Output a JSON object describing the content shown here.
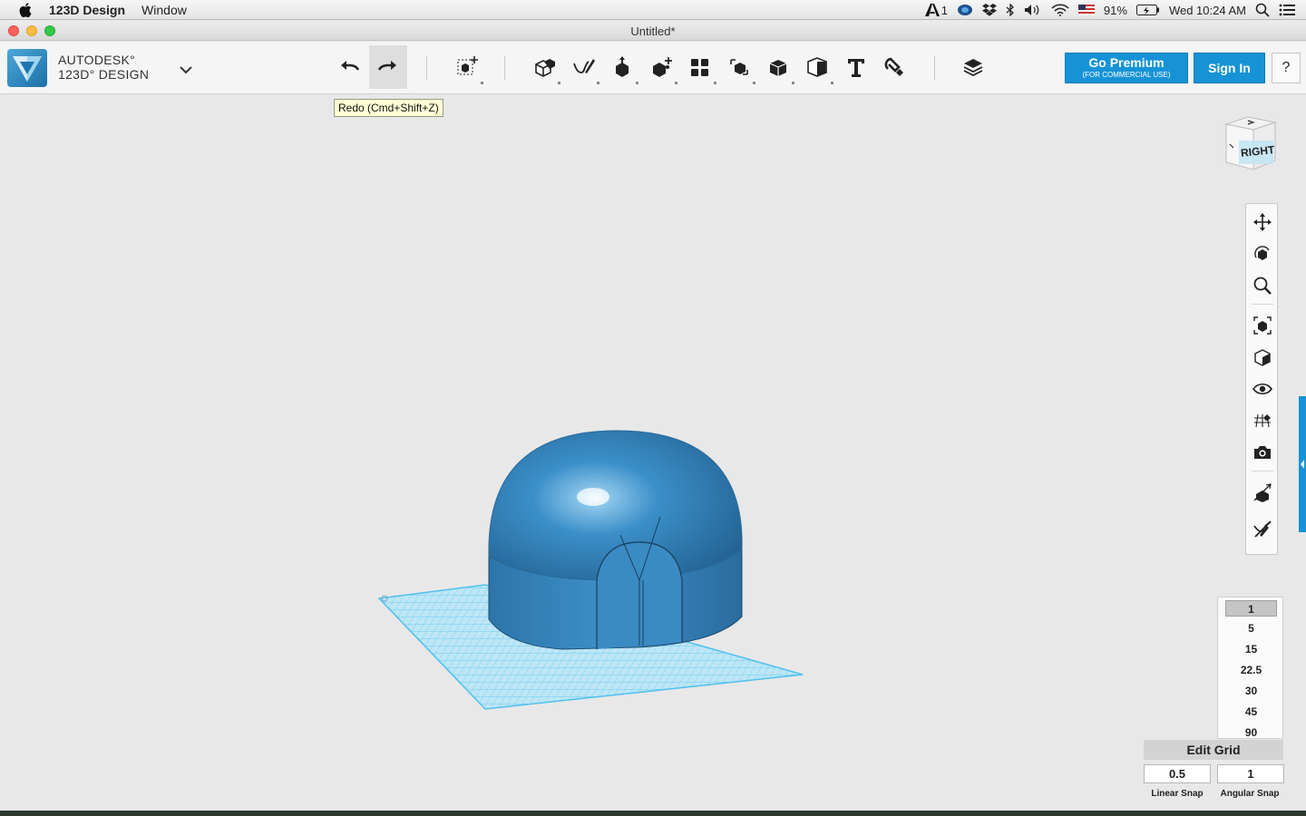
{
  "menubar": {
    "app_name": "123D Design",
    "menus": [
      "Window"
    ],
    "status": {
      "ai_badge": "1",
      "battery": "91%",
      "clock": "Wed 10:24 AM"
    }
  },
  "window": {
    "title": "Untitled*"
  },
  "toolbar": {
    "brand_line1": "AUTODESK°",
    "brand_line2": "123D° DESIGN",
    "undo_icon": "undo-arrow-icon",
    "redo_icon": "redo-arrow-icon",
    "tools": [
      "transform-icon",
      "primitives-icon",
      "sketch-icon",
      "construct-icon",
      "modify-icon",
      "pattern-icon",
      "group-icon",
      "combine-icon",
      "measure-icon",
      "text-icon",
      "snap-icon",
      "materials-icon"
    ],
    "premium_label": "Go Premium",
    "premium_sublabel": "(FOR COMMERCIAL USE)",
    "signin_label": "Sign In",
    "help_label": "?"
  },
  "tooltip": {
    "text": "Redo (Cmd+Shift+Z)"
  },
  "viewcube": {
    "face_label": "RIGHT"
  },
  "navbar": {
    "icons": [
      "pan-icon",
      "orbit-icon",
      "zoom-icon",
      "fit-icon",
      "view-icon",
      "visibility-icon",
      "grid-material-icon",
      "camera-icon",
      "show-solids-icon",
      "hide-sketches-icon"
    ]
  },
  "snap": {
    "angles": [
      "1",
      "5",
      "15",
      "22.5",
      "30",
      "45",
      "90"
    ],
    "selected_angle": "1",
    "edit_grid_label": "Edit Grid",
    "linear_snap_value": "0.5",
    "angular_snap_value": "1",
    "linear_snap_label": "Linear Snap",
    "angular_snap_label": "Angular Snap"
  },
  "colors": {
    "accent": "#1693d6",
    "model": "#3b8fc9",
    "grid": "#56c4ef"
  }
}
